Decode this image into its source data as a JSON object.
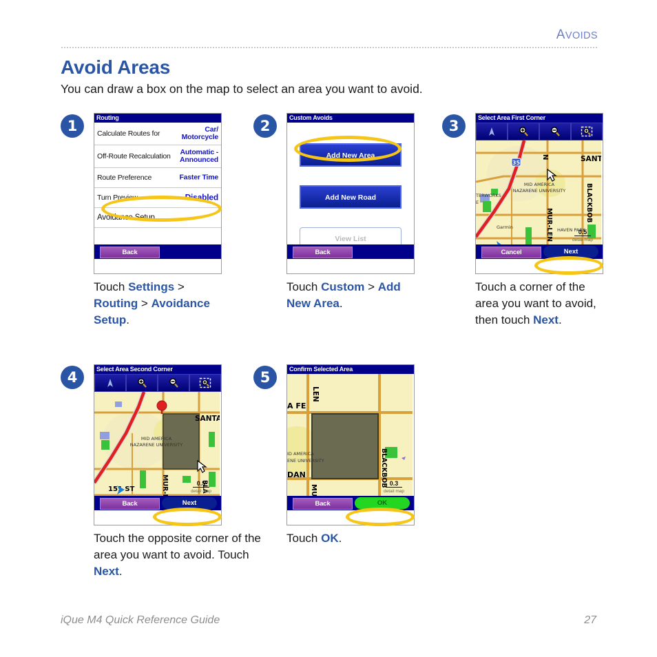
{
  "runhead": {
    "first": "A",
    "rest": "VOIDS"
  },
  "heading": "Avoid Areas",
  "intro": "You can draw a box on the map to select an area you want to avoid.",
  "footer": {
    "left": "iQue M4 Quick Reference Guide",
    "page": "27"
  },
  "colors": {
    "accent_blue": "#2a55a5",
    "highlight_yellow": "#f5c518",
    "device_titlebar": "#00008b",
    "back_button_purple": "#7e2f9e",
    "ok_green": "#22d622",
    "map_land": "#f7f1c0",
    "road_orange": "#d8a03c",
    "highway_red": "#e02020"
  },
  "steps": [
    {
      "number": "1"
    },
    {
      "number": "2"
    },
    {
      "number": "3"
    },
    {
      "number": "4"
    },
    {
      "number": "5"
    }
  ],
  "screen1": {
    "title": "Routing",
    "rows": [
      {
        "label": "Calculate Routes for",
        "value": "Car/\nMotorcycle"
      },
      {
        "label": "Off-Route Recalculation",
        "value": "Automatic -\nAnnounced"
      },
      {
        "label": "Route Preference",
        "value": "Faster Time"
      },
      {
        "label": "Turn Preview",
        "value": "Disabled"
      },
      {
        "label": "Avoidance Setup",
        "value": ""
      }
    ],
    "back_label": "Back"
  },
  "screen2": {
    "title": "Custom Avoids",
    "add_new_area": "Add New Area",
    "add_new_road": "Add New Road",
    "view_list": "View List",
    "back_label": "Back"
  },
  "screen3": {
    "title": "Select Area First Corner",
    "toolbar": [
      "north-arrow-icon",
      "zoom-in-icon",
      "zoom-out-icon",
      "zoom-to-area-icon"
    ],
    "map_labels": [
      "SANTA",
      "MID AMERICA",
      "NAZARENE UNIVERSITY",
      "MUR-LEN",
      "BLACKBOB",
      "HAVEN PARK",
      "TERWORKS",
      "Garmin",
      "35"
    ],
    "scale": "0.5",
    "scale_sub": "detail map",
    "cancel_label": "Cancel",
    "next_label": "Next"
  },
  "screen4": {
    "title": "Select Area Second Corner",
    "toolbar": [
      "north-arrow-icon",
      "zoom-in-icon",
      "zoom-out-icon",
      "zoom-to-area-icon"
    ],
    "map_labels": [
      "SANTA F",
      "MID AMERICA",
      "NAZARENE UNIVERSITY",
      "MUR-LEN",
      "BLA",
      "151 ST"
    ],
    "scale": "0.5",
    "scale_sub": "detail map",
    "back_label": "Back",
    "next_label": "Next"
  },
  "screen5": {
    "title": "Confirm Selected Area",
    "map_labels": [
      "LEN",
      "A FE",
      "ID AMERICA",
      "ENE UNIVERSITY",
      "DAN",
      "MUR-LEN",
      "BLACKBOB"
    ],
    "scale": "0.3",
    "scale_sub": "detail map",
    "back_label": "Back",
    "ok_label": "OK"
  },
  "captions": {
    "c1": {
      "p1": "Touch ",
      "b1": "Settings",
      "p2": " > ",
      "b2": "Routing",
      "p3": " > ",
      "b3": "Avoidance Setup",
      "p4": "."
    },
    "c2": {
      "p1": "Touch ",
      "b1": "Custom",
      "p2": " > ",
      "b2": "Add New Area",
      "p3": "."
    },
    "c3": {
      "p1": "Touch a corner of the area you want to avoid, then touch ",
      "b1": "Next",
      "p2": "."
    },
    "c4": {
      "p1": "Touch the opposite corner of the area you want to avoid. Touch ",
      "b1": "Next",
      "p2": "."
    },
    "c5": {
      "p1": "Touch ",
      "b1": "OK",
      "p2": "."
    }
  }
}
